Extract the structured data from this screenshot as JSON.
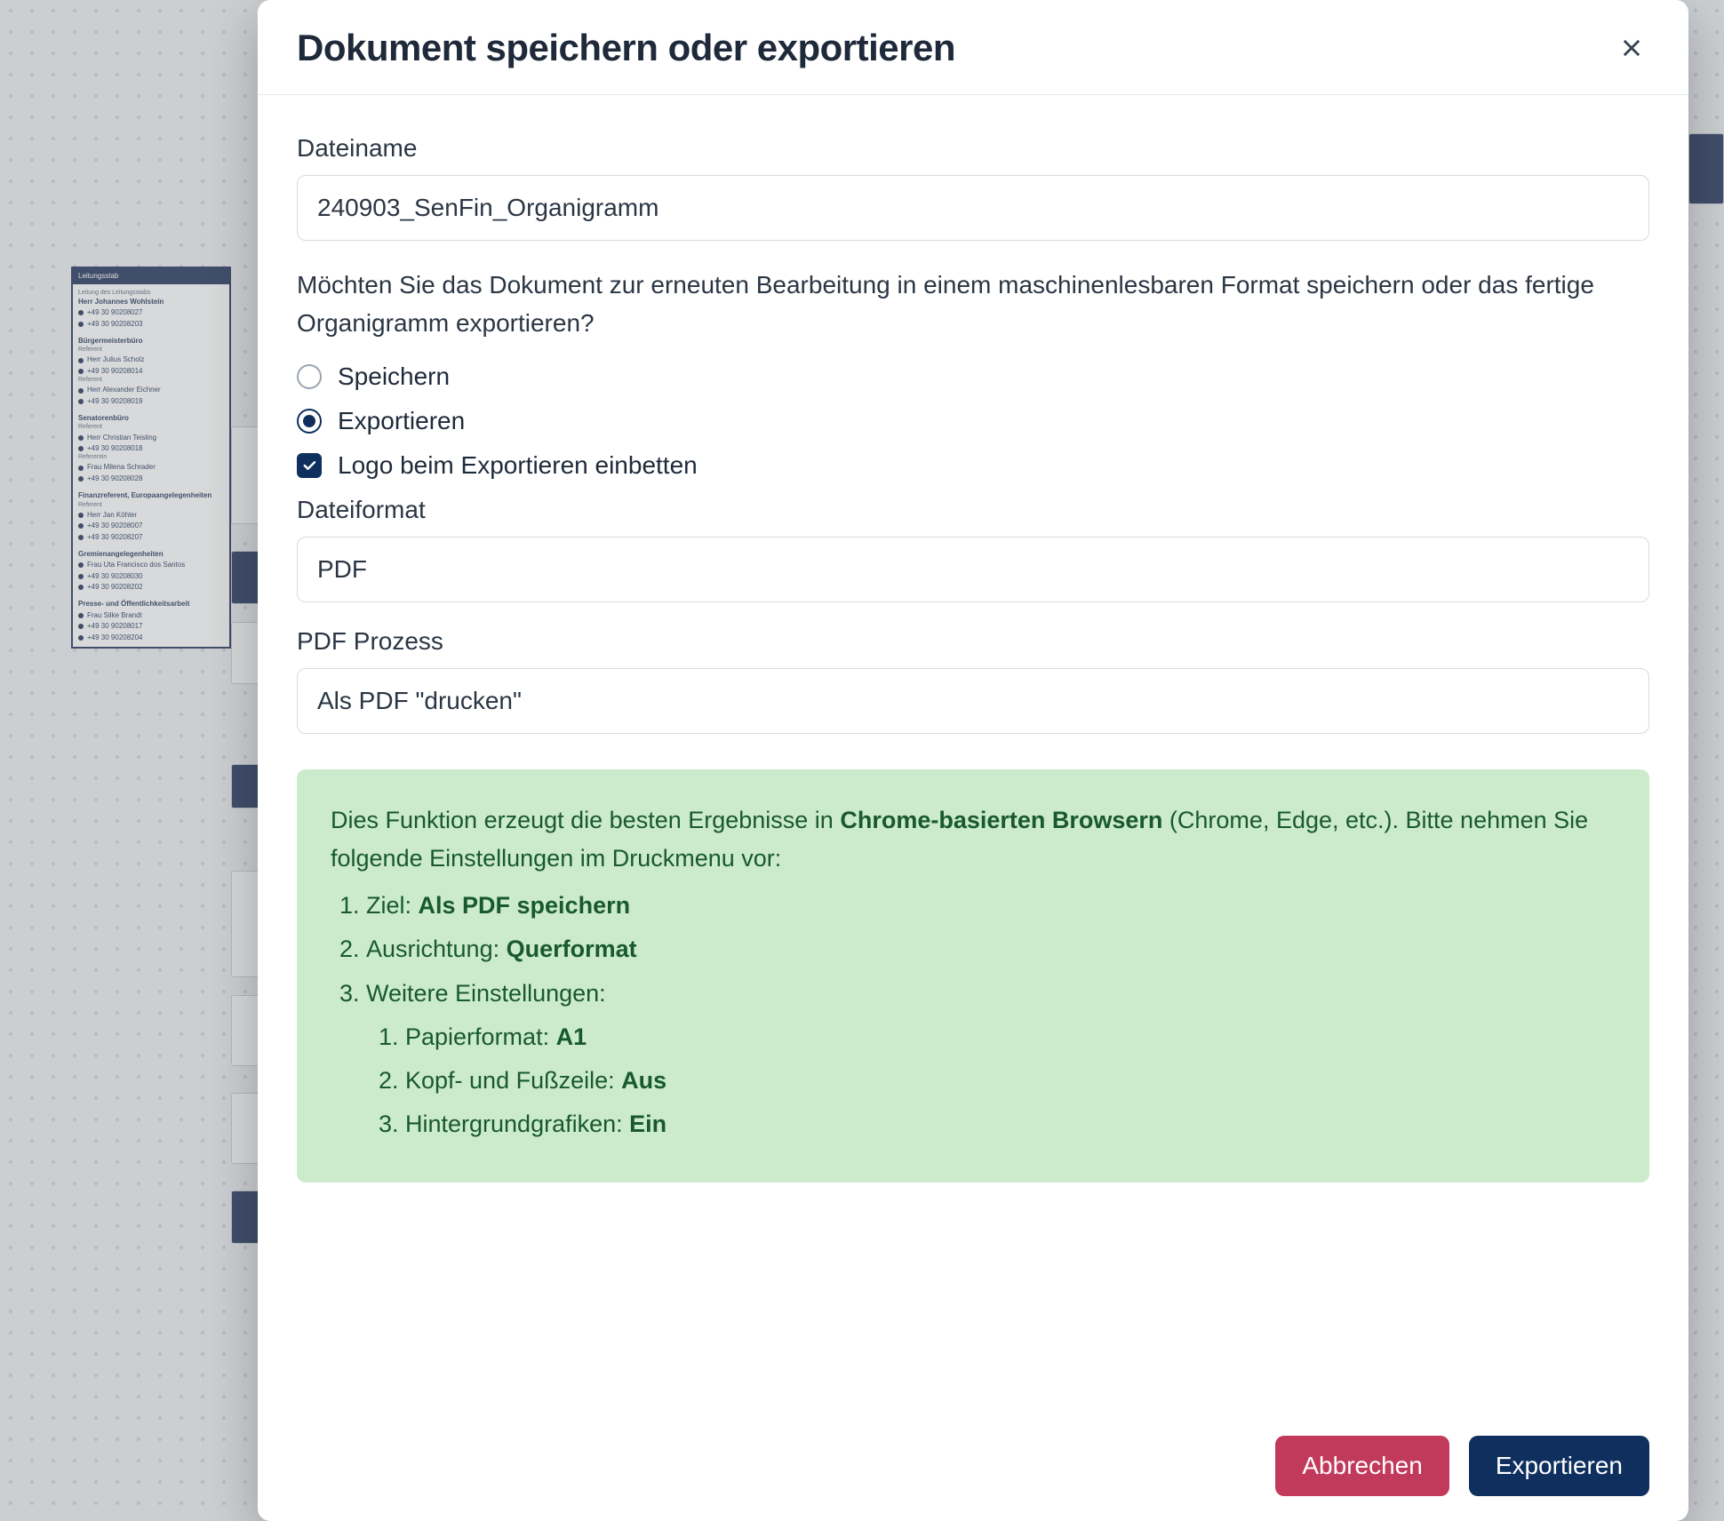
{
  "dialog": {
    "title": "Dokument speichern oder exportieren",
    "filename_label": "Dateiname",
    "filename_value": "240903_SenFin_Organigramm",
    "question": "Möchten Sie das Dokument zur erneuten Bearbeitung in einem maschinenlesbaren Format speichern oder das fertige Organigramm exportieren?",
    "radio_save": "Speichern",
    "radio_export": "Exportieren",
    "embed_logo": "Logo beim Exportieren einbetten",
    "format_label": "Dateiformat",
    "format_value": "PDF",
    "process_label": "PDF Prozess",
    "process_value": "Als PDF \"drucken\"",
    "info": {
      "lead_pre": "Dies Funktion erzeugt die besten Ergebnisse in ",
      "lead_bold": "Chrome-basierten Browsern",
      "lead_post": " (Chrome, Edge, etc.). Bitte nehmen Sie folgende Einstellungen im Druckmenu vor:",
      "i1_label": "Ziel: ",
      "i1_value": "Als PDF speichern",
      "i2_label": "Ausrichtung: ",
      "i2_value": "Querformat",
      "i3_label": "Weitere Einstellungen:",
      "i3a_label": "Papierformat: ",
      "i3a_value": "A1",
      "i3b_label": "Kopf- und Fußzeile: ",
      "i3b_value": "Aus",
      "i3c_label": "Hintergrundgrafiken: ",
      "i3c_value": "Ein"
    },
    "cancel": "Abbrechen",
    "submit": "Exportieren"
  },
  "background": {
    "card_title": "Leitungsstab",
    "s1_head": "Leitung des Leitungsstabs",
    "s1_name": "Herr Johannes Wohlstein",
    "s1_p1": "+49 30 90208027",
    "s1_p2": "+49 30 90208203",
    "s2_head": "Bürgermeisterbüro",
    "s2_r1": "Referent",
    "s2_n1": "Herr Julius Scholz",
    "s2_p1": "+49 30 90208014",
    "s2_r2": "Referent",
    "s2_n2": "Herr Alexander Eichner",
    "s2_p2": "+49 30 90208019",
    "s3_head": "Senatorenbüro",
    "s3_r1": "Referent",
    "s3_n1": "Herr Christian Teisling",
    "s3_p1": "+49 30 90208018",
    "s3_r2": "Referentin",
    "s3_n2": "Frau Milena Schrader",
    "s3_p2": "+49 30 90208028",
    "s4_head": "Finanzreferent, Europaangelegenheiten",
    "s4_r1": "Referent",
    "s4_n1": "Herr Jan Köhler",
    "s4_p1": "+49 30 90208007",
    "s4_p2": "+49 30 90208207",
    "s5_head": "Gremienangelegenheiten",
    "s5_n1": "Frau Uta Francisco dos Santos",
    "s5_p1": "+49 30 90208030",
    "s5_p2": "+49 30 90208202",
    "s6_head": "Presse- und Öffentlichkeitsarbeit",
    "s6_n1": "Frau Silke Brandt",
    "s6_p1": "+49 30 90208017",
    "s6_p2": "+49 30 90208204"
  }
}
